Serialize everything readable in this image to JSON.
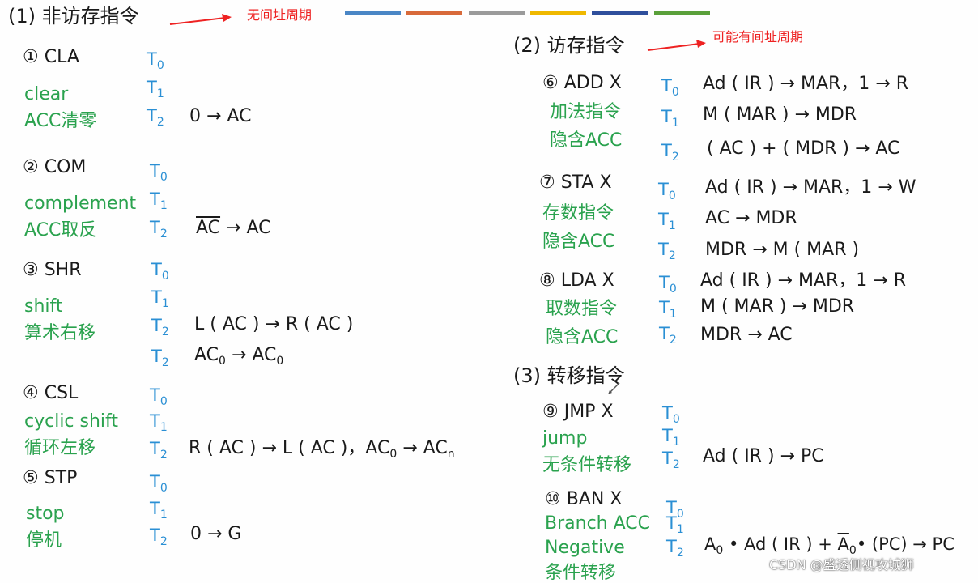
{
  "sections": {
    "s1": "(1) 非访存指令",
    "s2": "(2) 访存指令",
    "s3": "(3) 转移指令"
  },
  "notes": {
    "no_indirect": "无间址周期",
    "may_indirect": "可能有间址周期"
  },
  "color_bars": [
    "#4a86c5",
    "#d86a3a",
    "#9b9b9b",
    "#efb800",
    "#2f4f9c",
    "#5aa03a"
  ],
  "t": {
    "t0": "T",
    "t1": "T",
    "t2": "T",
    "s0": "0",
    "s1": "1",
    "s2": "2"
  },
  "cla": {
    "head": "① CLA",
    "en": "clear",
    "cn": "ACC清零",
    "op": "0 → AC"
  },
  "com": {
    "head": "② COM",
    "en": "complement",
    "cn": "ACC取反",
    "op_a": "AC",
    "op_b": " → AC"
  },
  "shr": {
    "head": "③ SHR",
    "en": "shift",
    "cn": "算术右移",
    "op1": "L ( AC ) → R ( AC )",
    "op2_a": "AC",
    "op2_s": "0",
    "op2_b": " → AC",
    "op2_s2": "0"
  },
  "csl": {
    "head": "④ CSL",
    "en": "cyclic shift",
    "cn": "循环左移",
    "op_a": "R ( AC ) → L ( AC )，AC",
    "op_s": "0",
    "op_b": " → AC",
    "op_s2": "n"
  },
  "stp": {
    "head": "⑤ STP",
    "en": "stop",
    "cn": "停机",
    "op": "0 → G"
  },
  "add": {
    "head": "⑥ ADD  X",
    "cn1": "加法指令",
    "cn2": "隐含ACC",
    "op0": "Ad ( IR ) → MAR，1 → R",
    "op1": "M ( MAR ) → MDR",
    "op2": "( AC ) + ( MDR ) → AC"
  },
  "sta": {
    "head": "⑦ STA  X",
    "cn1": "存数指令",
    "cn2": "隐含ACC",
    "op0": "Ad ( IR ) → MAR，1 → W",
    "op1": "AC → MDR",
    "op2": "MDR → M ( MAR )"
  },
  "lda": {
    "head": "⑧ LDA  X",
    "cn1": "取数指令",
    "cn2": "隐含ACC",
    "op0": "Ad ( IR ) → MAR，1 → R",
    "op1": "M ( MAR ) → MDR",
    "op2": "MDR → AC"
  },
  "jmp": {
    "head": "⑨ JMP  X",
    "en": "jump",
    "cn": "无条件转移",
    "op": "Ad ( IR ) → PC"
  },
  "ban": {
    "head": "⑩ BAN  X",
    "en1": "Branch ACC",
    "en2": "Negative",
    "cn": "条件转移",
    "op_a": "A",
    "op_s": "0",
    "op_b": " • Ad ( IR ) + ",
    "op_c": "A",
    "op_s2": "0",
    "op_d": "• (PC) → PC"
  },
  "watermark": "CSDN @盛透侧视攻城狮"
}
